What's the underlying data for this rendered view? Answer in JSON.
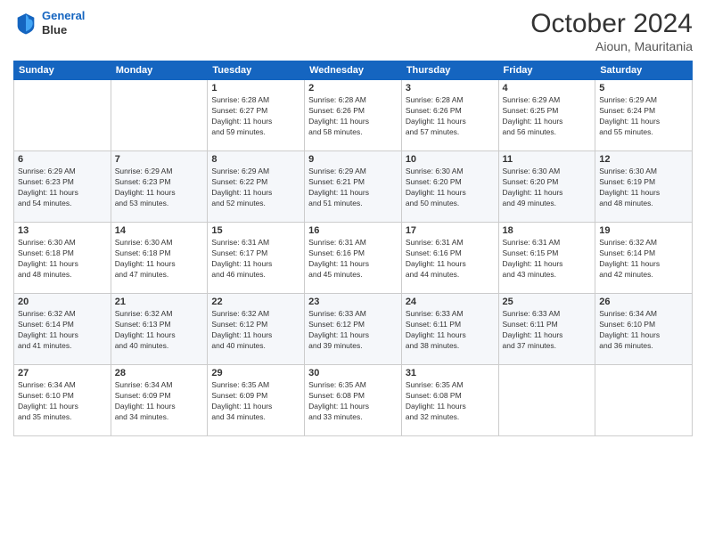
{
  "header": {
    "logo_line1": "General",
    "logo_line2": "Blue",
    "month_title": "October 2024",
    "subtitle": "Aioun, Mauritania"
  },
  "weekdays": [
    "Sunday",
    "Monday",
    "Tuesday",
    "Wednesday",
    "Thursday",
    "Friday",
    "Saturday"
  ],
  "weeks": [
    [
      {
        "day": "",
        "info": ""
      },
      {
        "day": "",
        "info": ""
      },
      {
        "day": "1",
        "info": "Sunrise: 6:28 AM\nSunset: 6:27 PM\nDaylight: 11 hours\nand 59 minutes."
      },
      {
        "day": "2",
        "info": "Sunrise: 6:28 AM\nSunset: 6:26 PM\nDaylight: 11 hours\nand 58 minutes."
      },
      {
        "day": "3",
        "info": "Sunrise: 6:28 AM\nSunset: 6:26 PM\nDaylight: 11 hours\nand 57 minutes."
      },
      {
        "day": "4",
        "info": "Sunrise: 6:29 AM\nSunset: 6:25 PM\nDaylight: 11 hours\nand 56 minutes."
      },
      {
        "day": "5",
        "info": "Sunrise: 6:29 AM\nSunset: 6:24 PM\nDaylight: 11 hours\nand 55 minutes."
      }
    ],
    [
      {
        "day": "6",
        "info": "Sunrise: 6:29 AM\nSunset: 6:23 PM\nDaylight: 11 hours\nand 54 minutes."
      },
      {
        "day": "7",
        "info": "Sunrise: 6:29 AM\nSunset: 6:23 PM\nDaylight: 11 hours\nand 53 minutes."
      },
      {
        "day": "8",
        "info": "Sunrise: 6:29 AM\nSunset: 6:22 PM\nDaylight: 11 hours\nand 52 minutes."
      },
      {
        "day": "9",
        "info": "Sunrise: 6:29 AM\nSunset: 6:21 PM\nDaylight: 11 hours\nand 51 minutes."
      },
      {
        "day": "10",
        "info": "Sunrise: 6:30 AM\nSunset: 6:20 PM\nDaylight: 11 hours\nand 50 minutes."
      },
      {
        "day": "11",
        "info": "Sunrise: 6:30 AM\nSunset: 6:20 PM\nDaylight: 11 hours\nand 49 minutes."
      },
      {
        "day": "12",
        "info": "Sunrise: 6:30 AM\nSunset: 6:19 PM\nDaylight: 11 hours\nand 48 minutes."
      }
    ],
    [
      {
        "day": "13",
        "info": "Sunrise: 6:30 AM\nSunset: 6:18 PM\nDaylight: 11 hours\nand 48 minutes."
      },
      {
        "day": "14",
        "info": "Sunrise: 6:30 AM\nSunset: 6:18 PM\nDaylight: 11 hours\nand 47 minutes."
      },
      {
        "day": "15",
        "info": "Sunrise: 6:31 AM\nSunset: 6:17 PM\nDaylight: 11 hours\nand 46 minutes."
      },
      {
        "day": "16",
        "info": "Sunrise: 6:31 AM\nSunset: 6:16 PM\nDaylight: 11 hours\nand 45 minutes."
      },
      {
        "day": "17",
        "info": "Sunrise: 6:31 AM\nSunset: 6:16 PM\nDaylight: 11 hours\nand 44 minutes."
      },
      {
        "day": "18",
        "info": "Sunrise: 6:31 AM\nSunset: 6:15 PM\nDaylight: 11 hours\nand 43 minutes."
      },
      {
        "day": "19",
        "info": "Sunrise: 6:32 AM\nSunset: 6:14 PM\nDaylight: 11 hours\nand 42 minutes."
      }
    ],
    [
      {
        "day": "20",
        "info": "Sunrise: 6:32 AM\nSunset: 6:14 PM\nDaylight: 11 hours\nand 41 minutes."
      },
      {
        "day": "21",
        "info": "Sunrise: 6:32 AM\nSunset: 6:13 PM\nDaylight: 11 hours\nand 40 minutes."
      },
      {
        "day": "22",
        "info": "Sunrise: 6:32 AM\nSunset: 6:12 PM\nDaylight: 11 hours\nand 40 minutes."
      },
      {
        "day": "23",
        "info": "Sunrise: 6:33 AM\nSunset: 6:12 PM\nDaylight: 11 hours\nand 39 minutes."
      },
      {
        "day": "24",
        "info": "Sunrise: 6:33 AM\nSunset: 6:11 PM\nDaylight: 11 hours\nand 38 minutes."
      },
      {
        "day": "25",
        "info": "Sunrise: 6:33 AM\nSunset: 6:11 PM\nDaylight: 11 hours\nand 37 minutes."
      },
      {
        "day": "26",
        "info": "Sunrise: 6:34 AM\nSunset: 6:10 PM\nDaylight: 11 hours\nand 36 minutes."
      }
    ],
    [
      {
        "day": "27",
        "info": "Sunrise: 6:34 AM\nSunset: 6:10 PM\nDaylight: 11 hours\nand 35 minutes."
      },
      {
        "day": "28",
        "info": "Sunrise: 6:34 AM\nSunset: 6:09 PM\nDaylight: 11 hours\nand 34 minutes."
      },
      {
        "day": "29",
        "info": "Sunrise: 6:35 AM\nSunset: 6:09 PM\nDaylight: 11 hours\nand 34 minutes."
      },
      {
        "day": "30",
        "info": "Sunrise: 6:35 AM\nSunset: 6:08 PM\nDaylight: 11 hours\nand 33 minutes."
      },
      {
        "day": "31",
        "info": "Sunrise: 6:35 AM\nSunset: 6:08 PM\nDaylight: 11 hours\nand 32 minutes."
      },
      {
        "day": "",
        "info": ""
      },
      {
        "day": "",
        "info": ""
      }
    ]
  ]
}
